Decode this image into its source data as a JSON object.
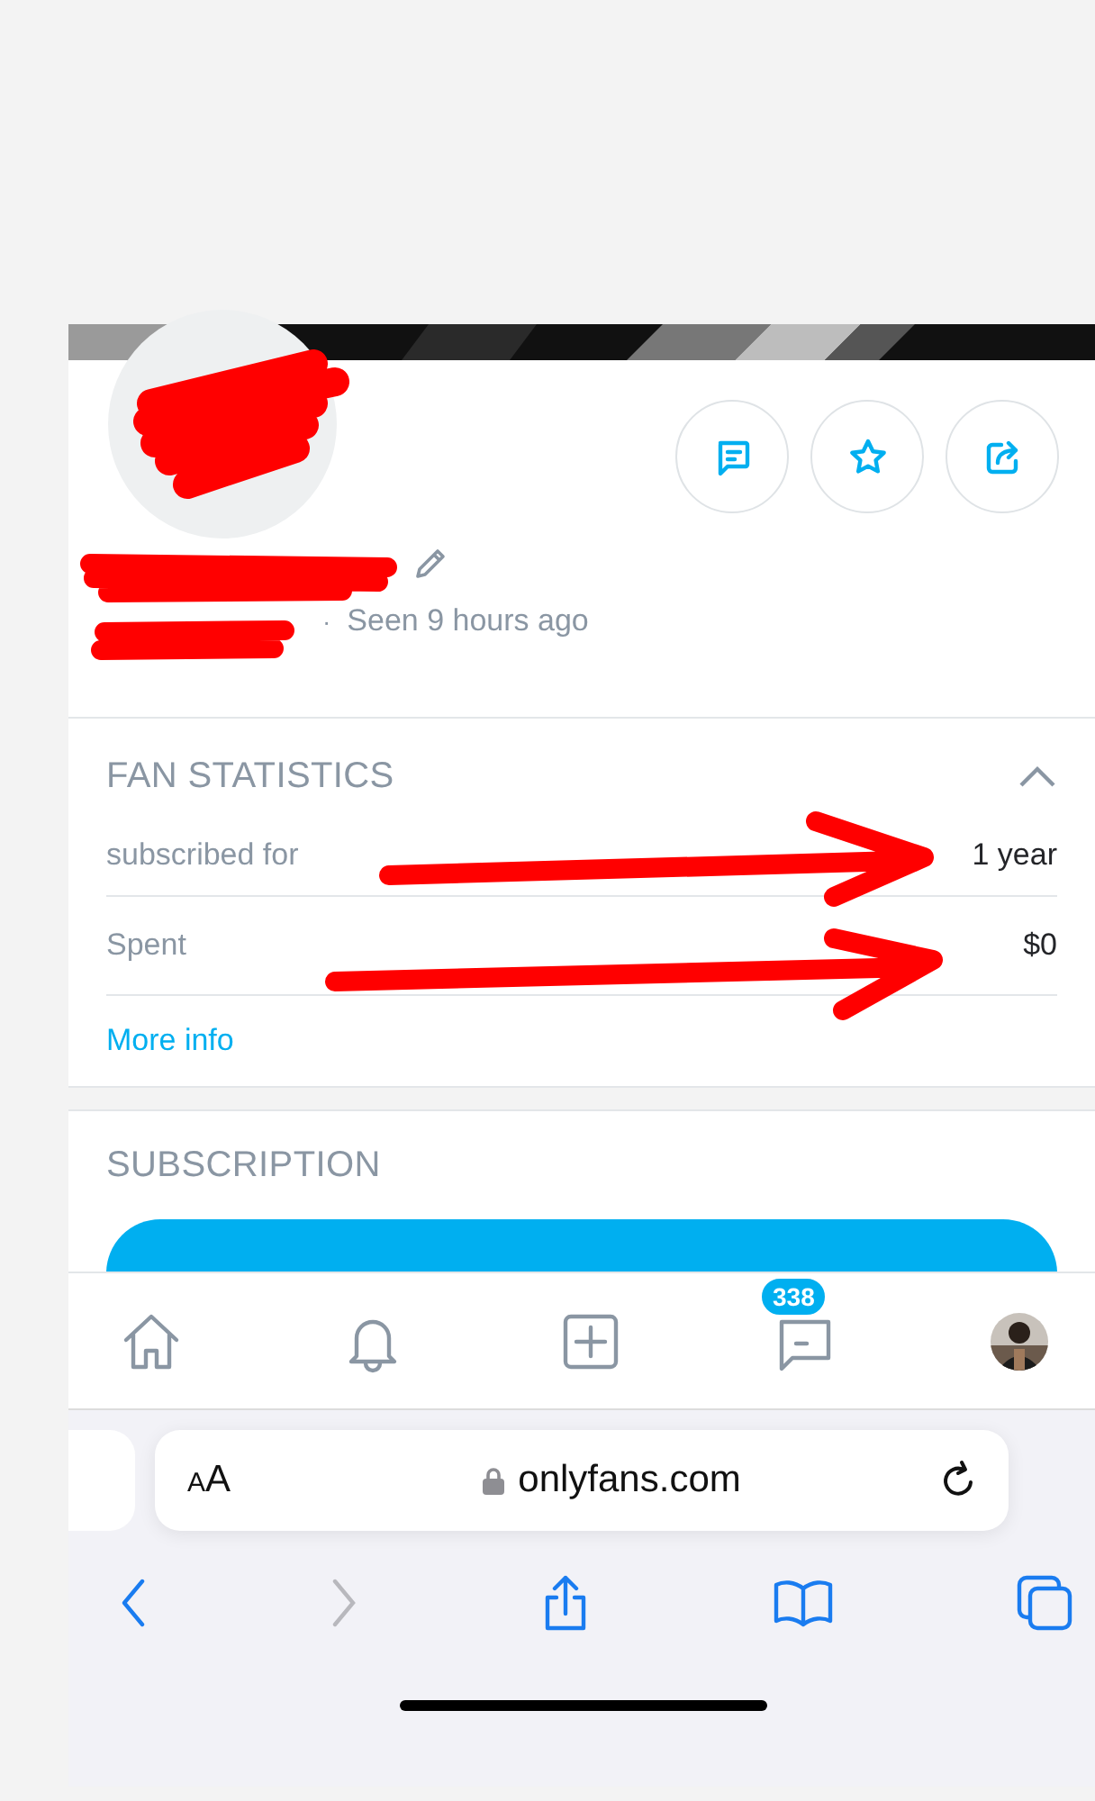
{
  "profile": {
    "separator": "·",
    "status": "Seen 9 hours ago"
  },
  "fan_statistics": {
    "title": "FAN STATISTICS",
    "expanded": true,
    "rows": [
      {
        "label": "subscribed for",
        "value": "1 year"
      },
      {
        "label": "Spent",
        "value": "$0"
      }
    ],
    "link": "More info"
  },
  "subscription": {
    "title": "SUBSCRIPTION"
  },
  "bottom_nav": {
    "messages_badge": "338"
  },
  "browser": {
    "text_size_button": "AA",
    "url": "onlyfans.com"
  }
}
